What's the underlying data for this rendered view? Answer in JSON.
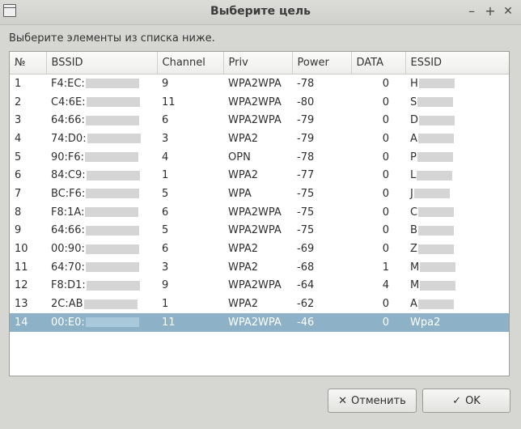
{
  "window": {
    "title": "Выберите цель",
    "controls": {
      "minimize": "–",
      "maximize": "+",
      "close": "✕"
    }
  },
  "prompt": "Выберите элементы из списка ниже.",
  "table": {
    "columns": [
      "№",
      "BSSID",
      "Channel",
      "Priv",
      "Power",
      "DATA",
      "ESSID"
    ],
    "rows": [
      [
        "1",
        "F4:EC:",
        "9",
        "WPA2WPA",
        "-78",
        "0",
        "H"
      ],
      [
        "2",
        "C4:6E:",
        "11",
        "WPA2WPA",
        "-80",
        "0",
        "S"
      ],
      [
        "3",
        "64:66:",
        "6",
        "WPA2WPA",
        "-79",
        "0",
        "D"
      ],
      [
        "4",
        "74:D0:",
        "3",
        "WPA2",
        "-79",
        "0",
        "A"
      ],
      [
        "5",
        "90:F6:",
        "4",
        "OPN",
        "-78",
        "0",
        "P"
      ],
      [
        "6",
        "84:C9:",
        "1",
        "WPA2",
        "-77",
        "0",
        "L"
      ],
      [
        "7",
        "BC:F6:",
        "5",
        "WPA",
        "-75",
        "0",
        "J"
      ],
      [
        "8",
        "F8:1A:",
        "6",
        "WPA2WPA",
        "-75",
        "0",
        "C"
      ],
      [
        "9",
        "64:66:",
        "5",
        "WPA2WPA",
        "-75",
        "0",
        "B"
      ],
      [
        "10",
        "00:90:",
        "6",
        "WPA2",
        "-69",
        "0",
        "Z"
      ],
      [
        "11",
        "64:70:",
        "3",
        "WPA2",
        "-68",
        "1",
        "M"
      ],
      [
        "12",
        "F8:D1:",
        "9",
        "WPA2WPA",
        "-64",
        "4",
        "M"
      ],
      [
        "13",
        "2C:AB",
        "1",
        "WPA2",
        "-62",
        "0",
        "A"
      ],
      [
        "14",
        "00:E0:",
        "11",
        "WPA2WPA",
        "-46",
        "0",
        "Wpa2"
      ]
    ],
    "selected_row": 14
  },
  "buttons": {
    "cancel": "Отменить",
    "ok": "OK"
  },
  "icons": {
    "cancel": "close-icon",
    "ok": "checkmark-icon"
  },
  "colors": {
    "selection": "#8db1c7",
    "background": "#d6d6d3"
  }
}
